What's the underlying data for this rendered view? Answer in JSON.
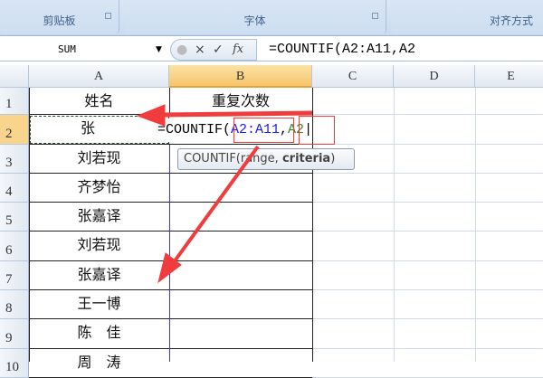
{
  "ribbon": {
    "groups": [
      {
        "label": "剪贴板"
      },
      {
        "label": "字体"
      },
      {
        "label": "对齐方式"
      }
    ]
  },
  "formula_bar": {
    "name_box": "SUM",
    "cancel_icon": "×",
    "enter_icon": "✓",
    "fx_label": "fx",
    "formula": "=COUNTIF(A2:A11,A2"
  },
  "columns": [
    "A",
    "B",
    "C",
    "D",
    "E"
  ],
  "rows": [
    "1",
    "2",
    "3",
    "4",
    "5",
    "6",
    "7",
    "8",
    "9",
    "10"
  ],
  "sheet": {
    "header_a": "姓名",
    "header_b": "重复次数",
    "names": [
      "张",
      "刘若现",
      "齐梦怡",
      "张嘉译",
      "刘若现",
      "张嘉译",
      "王一博",
      "陈　佳",
      "周　涛"
    ]
  },
  "edit": {
    "prefix": "=COUNTIF(",
    "range": "A2:A11",
    "comma": ",",
    "criteria": "A2"
  },
  "tooltip": {
    "func": "COUNTIF(range, ",
    "arg": "criteria",
    ")": ")",
    "close": ")"
  },
  "colors": {
    "range": "#1a1aff",
    "criteria": "#2e8b2e",
    "annotation": "#f03c3c"
  }
}
